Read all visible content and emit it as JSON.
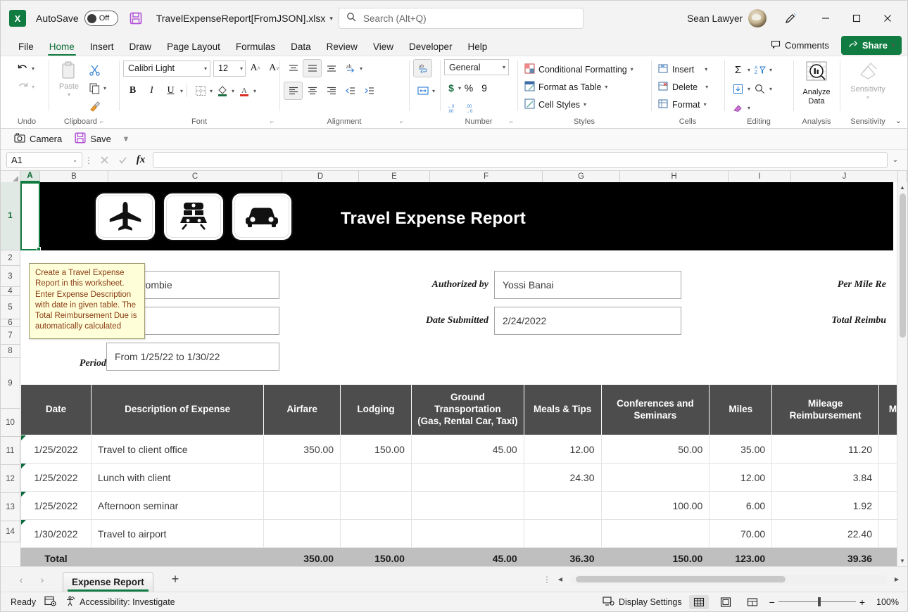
{
  "titlebar": {
    "app_logo": "excel-logo",
    "autosave_label": "AutoSave",
    "autosave_state": "Off",
    "filename": "TravelExpenseReport[FromJSON].xlsx",
    "search_placeholder": "Search (Alt+Q)",
    "user_name": "Sean Lawyer"
  },
  "tabs": [
    {
      "label": "File",
      "active": false
    },
    {
      "label": "Home",
      "active": true
    },
    {
      "label": "Insert",
      "active": false
    },
    {
      "label": "Draw",
      "active": false
    },
    {
      "label": "Page Layout",
      "active": false
    },
    {
      "label": "Formulas",
      "active": false
    },
    {
      "label": "Data",
      "active": false
    },
    {
      "label": "Review",
      "active": false
    },
    {
      "label": "View",
      "active": false
    },
    {
      "label": "Developer",
      "active": false
    },
    {
      "label": "Help",
      "active": false
    }
  ],
  "tabstrip_right": {
    "comments_label": "Comments",
    "share_label": "Share"
  },
  "ribbon": {
    "groups": {
      "undo": {
        "label": "Undo"
      },
      "clipboard": {
        "label": "Clipboard",
        "paste_label": "Paste"
      },
      "font": {
        "label": "Font",
        "font_name": "Calibri Light",
        "font_size": "12"
      },
      "alignment": {
        "label": "Alignment"
      },
      "number": {
        "label": "Number",
        "format": "General"
      },
      "styles": {
        "label": "Styles",
        "conditional_formatting": "Conditional Formatting",
        "format_as_table": "Format as Table",
        "cell_styles": "Cell Styles"
      },
      "cells": {
        "label": "Cells",
        "insert": "Insert",
        "delete": "Delete",
        "format": "Format"
      },
      "editing": {
        "label": "Editing"
      },
      "analysis": {
        "label": "Analysis",
        "analyze_data": "Analyze\nData",
        "analyze_line1": "Analyze",
        "analyze_line2": "Data"
      },
      "sensitivity": {
        "label": "Sensitivity",
        "button_label": "Sensitivity"
      }
    }
  },
  "qat": {
    "camera_label": "Camera",
    "save_label": "Save"
  },
  "formula_bar": {
    "name_box": "A1",
    "formula_value": ""
  },
  "grid": {
    "columns": [
      "A",
      "B",
      "C",
      "D",
      "E",
      "F",
      "G",
      "H",
      "I",
      "J"
    ],
    "rows": [
      "1",
      "2",
      "3",
      "4",
      "5",
      "6",
      "7",
      "8",
      "9",
      "10",
      "11",
      "12",
      "13",
      "14"
    ],
    "selected_cell": "A1"
  },
  "comment_tooltip": {
    "text": "Create a Travel Expense Report in this worksheet. Enter Expense Description with date in given table. The Total Reimbursement Due is automatically calculated"
  },
  "sheet": {
    "banner_title": "Travel Expense Report",
    "icons": [
      "airplane-icon",
      "train-icon",
      "car-icon"
    ],
    "form": {
      "name_value": "mbercrombie",
      "blank_value": "",
      "period_label": "Period",
      "period_value": "From 1/25/22 to 1/30/22",
      "authorized_by_label": "Authorized by",
      "authorized_by_value": "Yossi Banai",
      "date_submitted_label": "Date Submitted",
      "date_submitted_value": "2/24/2022",
      "per_mile_label": "Per Mile Re",
      "total_reimb_label": "Total Reimbu"
    },
    "table": {
      "headers": [
        "Date",
        "Description of Expense",
        "Airfare",
        "Lodging",
        "Ground Transportation (Gas, Rental Car, Taxi)",
        "Meals & Tips",
        "Conferences and Seminars",
        "Miles",
        "Mileage Reimbursement",
        "M"
      ],
      "header_ground_line1": "Ground",
      "header_ground_line2": "Transportation",
      "header_ground_line3": "(Gas, Rental Car, Taxi)",
      "header_conf_line1": "Conferences and",
      "header_conf_line2": "Seminars",
      "header_mileage_line1": "Mileage",
      "header_mileage_line2": "Reimbursement",
      "rows": [
        {
          "date": "1/25/2022",
          "description": "Travel to client office",
          "airfare": "350.00",
          "lodging": "150.00",
          "ground": "45.00",
          "meals": "12.00",
          "conferences": "50.00",
          "miles": "35.00",
          "mileage_reimb": "11.20",
          "last": ""
        },
        {
          "date": "1/25/2022",
          "description": "Lunch with client",
          "airfare": "",
          "lodging": "",
          "ground": "",
          "meals": "24.30",
          "conferences": "",
          "miles": "12.00",
          "mileage_reimb": "3.84",
          "last": ""
        },
        {
          "date": "1/25/2022",
          "description": "Afternoon seminar",
          "airfare": "",
          "lodging": "",
          "ground": "",
          "meals": "",
          "conferences": "100.00",
          "miles": "6.00",
          "mileage_reimb": "1.92",
          "last": ""
        },
        {
          "date": "1/30/2022",
          "description": "Travel to airport",
          "airfare": "",
          "lodging": "",
          "ground": "",
          "meals": "",
          "conferences": "",
          "miles": "70.00",
          "mileage_reimb": "22.40",
          "last": ""
        }
      ],
      "total_row": {
        "date": "Total",
        "description": "",
        "airfare": "350.00",
        "lodging": "150.00",
        "ground": "45.00",
        "meals": "36.30",
        "conferences": "150.00",
        "miles": "123.00",
        "mileage_reimb": "39.36",
        "last": ""
      }
    }
  },
  "sheet_tabs": {
    "active_tab": "Expense Report"
  },
  "statusbar": {
    "state": "Ready",
    "accessibility": "Accessibility: Investigate",
    "display_settings": "Display Settings",
    "zoom": "100%"
  },
  "colors": {
    "excel_green": "#107c41",
    "header_gray": "#4d4d4d",
    "total_gray": "#bfbfbf",
    "banner_black": "#000000",
    "comment_marker": "#0b6b3a",
    "tooltip_bg": "#feffd9",
    "tooltip_text": "#8a3a12"
  }
}
